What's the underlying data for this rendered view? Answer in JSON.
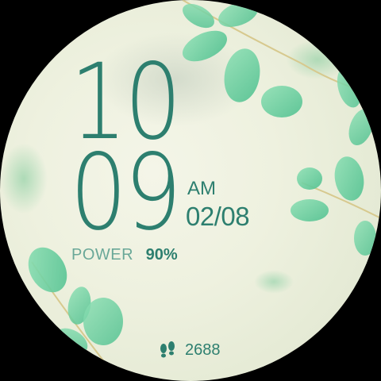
{
  "watchface": {
    "time": {
      "hour": "10",
      "minute": "09",
      "meridiem": "AM"
    },
    "date": "02/08",
    "power": {
      "label": "POWER",
      "value": "90%"
    },
    "steps": {
      "icon": "footsteps-icon",
      "value": "2688"
    }
  },
  "colors": {
    "primary_text": "#2d7f6f",
    "secondary_text": "#6aa898",
    "background": "#eef1df",
    "leaf": "#6fd3a0"
  }
}
